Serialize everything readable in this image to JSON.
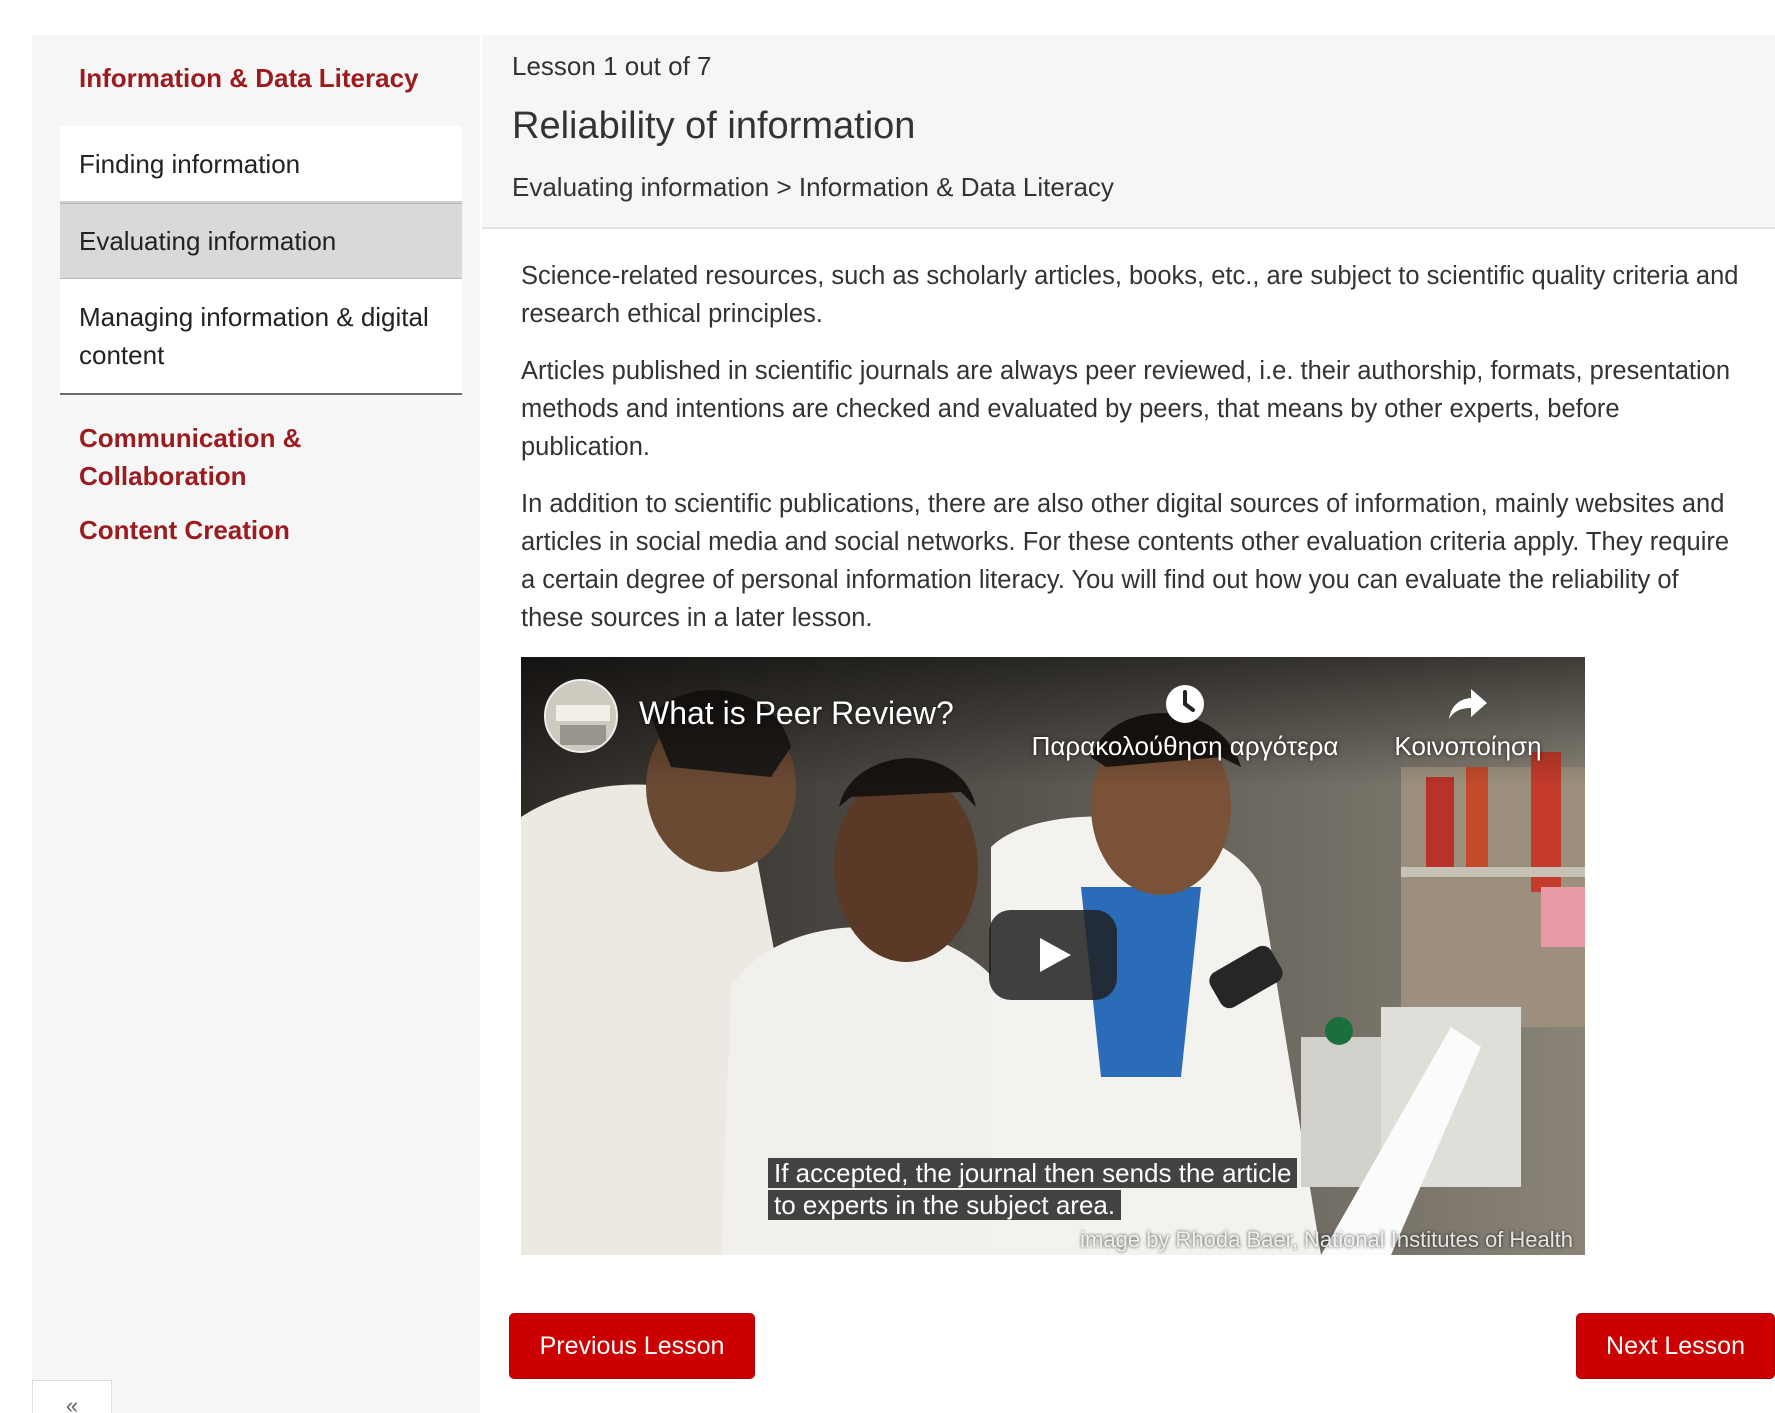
{
  "sidebar": {
    "section_1": "Information & Data Literacy",
    "items": [
      {
        "label": "Finding information"
      },
      {
        "label": "Evaluating information"
      },
      {
        "label": "Managing information & digital content"
      }
    ],
    "section_2": "Communication & Collaboration",
    "section_3": "Content Creation",
    "collapse_icon": "double-chevron-left-icon"
  },
  "header": {
    "lesson_count": "Lesson 1 out of 7",
    "title": "Reliability of information",
    "breadcrumb": "Evaluating information > Information & Data Literacy"
  },
  "content": {
    "paragraphs": [
      "Science-related resources, such as scholarly articles, books, etc., are subject to scientific quality criteria and research ethical principles.",
      "Articles published in scientific journals are always peer reviewed, i.e. their authorship, formats, presentation methods and intentions are checked and evaluated by peers, that means by other experts, before publication.",
      "In addition to scientific publications, there are also other digital sources of information, mainly websites and articles in social media and social networks. For these contents other evaluation criteria apply. They require a certain degree of personal information literacy. You will find out how you can evaluate the reliability of these sources in a later lesson."
    ]
  },
  "video": {
    "title": "What is Peer Review?",
    "watch_later": "Παρακολούθηση αργότερα",
    "share": "Κοινοποίηση",
    "caption_line_1": "If accepted, the journal then sends the article",
    "caption_line_2": "to experts in the subject area.",
    "credit": "image by Rhoda Baer, National Institutes of Health"
  },
  "nav": {
    "previous": "Previous Lesson",
    "next": "Next Lesson"
  },
  "colors": {
    "accent": "#9b1b1f",
    "button": "#cc0000",
    "sidebar_bg": "#f6f6f6",
    "active_item_bg": "#d9d9d9"
  }
}
